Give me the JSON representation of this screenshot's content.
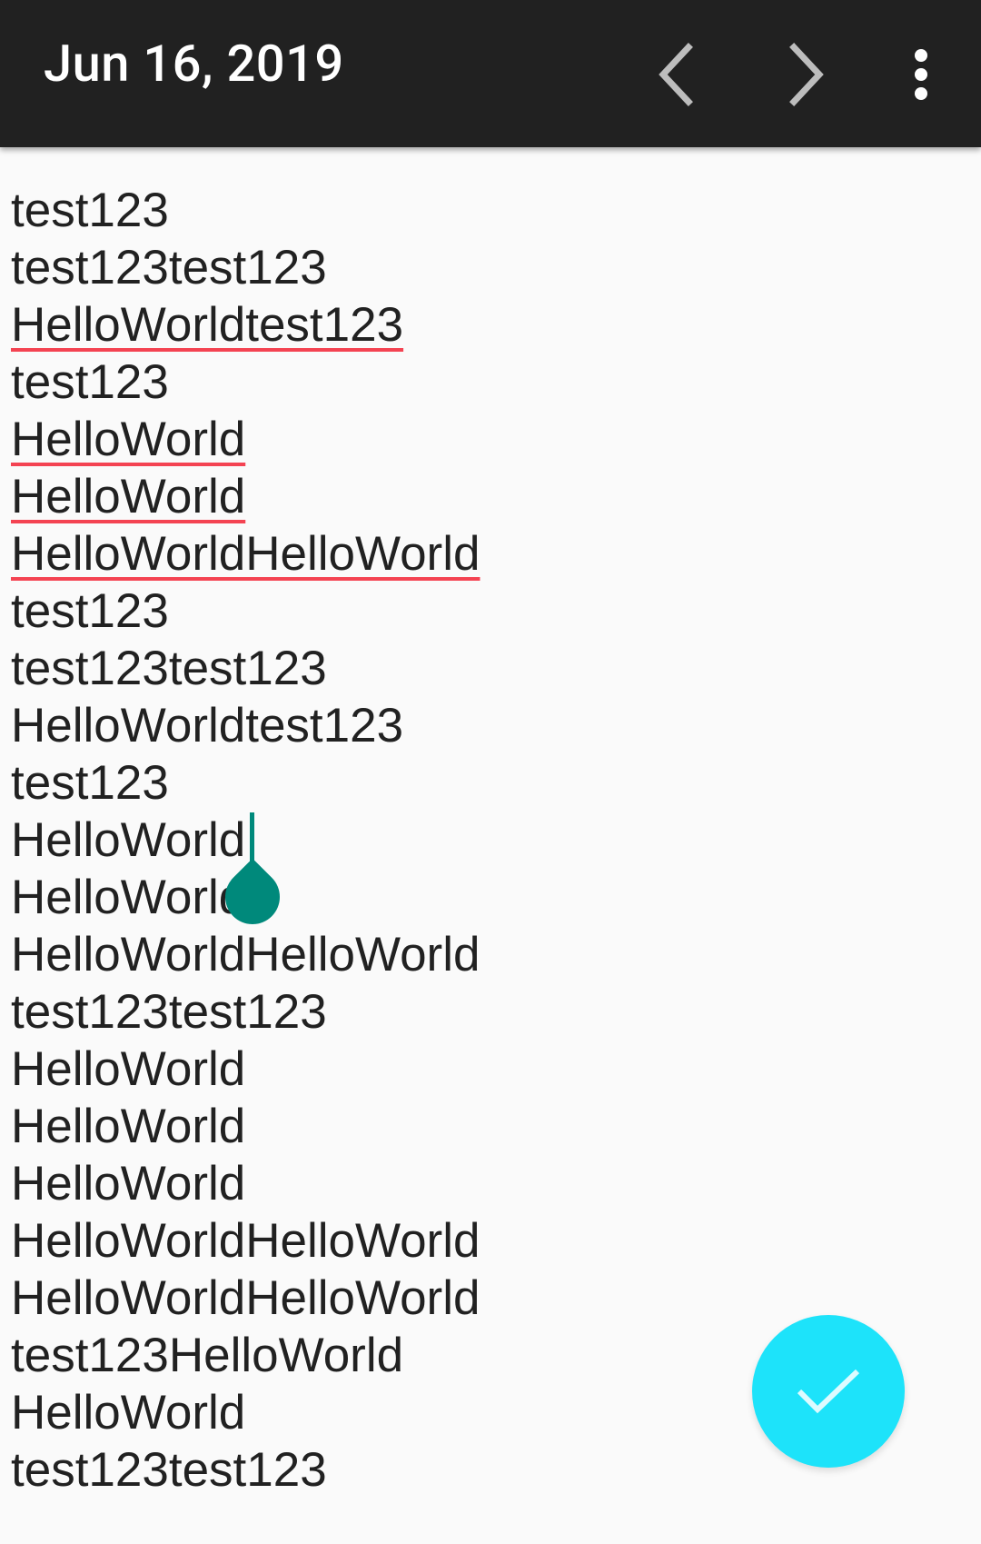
{
  "appbar": {
    "title": "Jun 16, 2019",
    "icons": [
      "chevron-left-icon",
      "chevron-right-icon",
      "more-vert-icon"
    ],
    "background": "#212121",
    "title_color": "#ffffff"
  },
  "editor": {
    "lines": [
      {
        "text": "test123",
        "spell_error": false
      },
      {
        "text": "test123test123",
        "spell_error": false
      },
      {
        "text": "HelloWorldtest123",
        "spell_error": true
      },
      {
        "text": "test123",
        "spell_error": false
      },
      {
        "text": "HelloWorld",
        "spell_error": true
      },
      {
        "text": "HelloWorld",
        "spell_error": true
      },
      {
        "text": "HelloWorldHelloWorld",
        "spell_error": true
      },
      {
        "text": "test123",
        "spell_error": false
      },
      {
        "text": "test123test123",
        "spell_error": false
      },
      {
        "text": "HelloWorldtest123",
        "spell_error": false
      },
      {
        "text": "test123",
        "spell_error": false
      },
      {
        "text": "HelloWorld",
        "spell_error": false
      },
      {
        "text": "HelloWorld",
        "spell_error": false
      },
      {
        "text": "HelloWorldHelloWorld",
        "spell_error": false
      },
      {
        "text": "test123test123",
        "spell_error": false
      },
      {
        "text": "HelloWorld",
        "spell_error": false
      },
      {
        "text": "HelloWorld",
        "spell_error": false
      },
      {
        "text": "HelloWorld",
        "spell_error": false
      },
      {
        "text": "HelloWorldHelloWorld",
        "spell_error": false
      },
      {
        "text": "HelloWorldHelloWorld",
        "spell_error": false
      },
      {
        "text": "test123HelloWorld",
        "spell_error": false
      },
      {
        "text": "HelloWorld",
        "spell_error": false
      },
      {
        "text": "test123test123",
        "spell_error": false
      }
    ],
    "spell_underline_color": "#f44352",
    "cursor_color": "#00897b"
  },
  "fab": {
    "icon": "check-icon",
    "color": "#1de3fa"
  }
}
